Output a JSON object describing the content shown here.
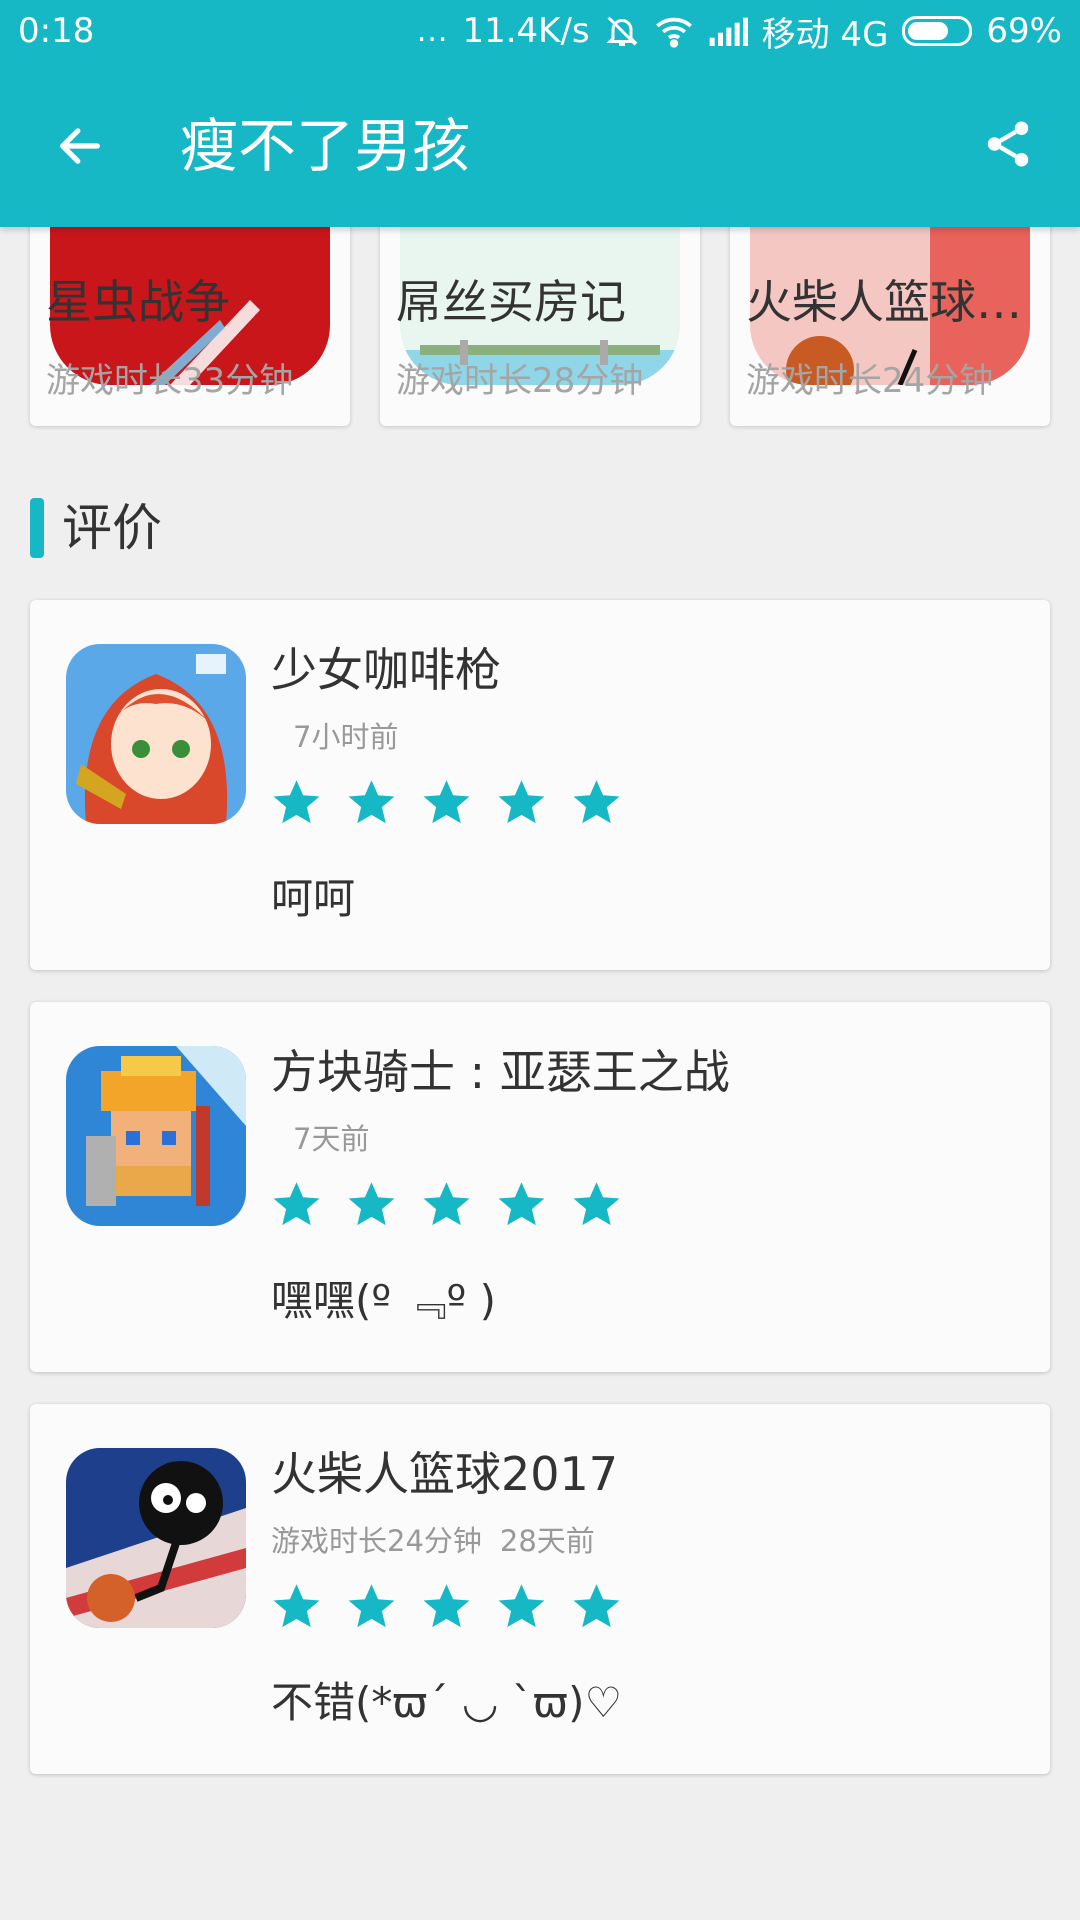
{
  "status_bar": {
    "time": "0:18",
    "dots": "...",
    "network_speed": "11.4K/s",
    "carrier": "移动 4G",
    "battery": "69%",
    "battery_level": 0.69
  },
  "app_bar": {
    "title": "瘦不了男孩",
    "back_icon": "arrow-back-icon",
    "share_icon": "share-icon"
  },
  "games": [
    {
      "name": "星虫战争",
      "meta": "游戏时长33分钟"
    },
    {
      "name": "屌丝买房记",
      "meta": "游戏时长28分钟"
    },
    {
      "name": "火柴人篮球2…",
      "meta": "游戏时长24分钟"
    }
  ],
  "section": {
    "title": "评价"
  },
  "reviews": [
    {
      "name": "少女咖啡枪",
      "meta": "",
      "time": "7小时前",
      "rating": 5,
      "text": "呵呵"
    },
    {
      "name": "方块骑士 : 亚瑟王之战",
      "meta": "",
      "time": "7天前",
      "rating": 5,
      "text": "嘿嘿(º ﹃º )"
    },
    {
      "name": "火柴人篮球2017",
      "meta": "游戏时长24分钟",
      "time": "28天前",
      "rating": 5,
      "text": "不错(*ϖ´ ◡ `ϖ)♡"
    }
  ],
  "colors": {
    "accent": "#17b8c6",
    "background": "#efefef",
    "card": "#fbfbfb"
  }
}
